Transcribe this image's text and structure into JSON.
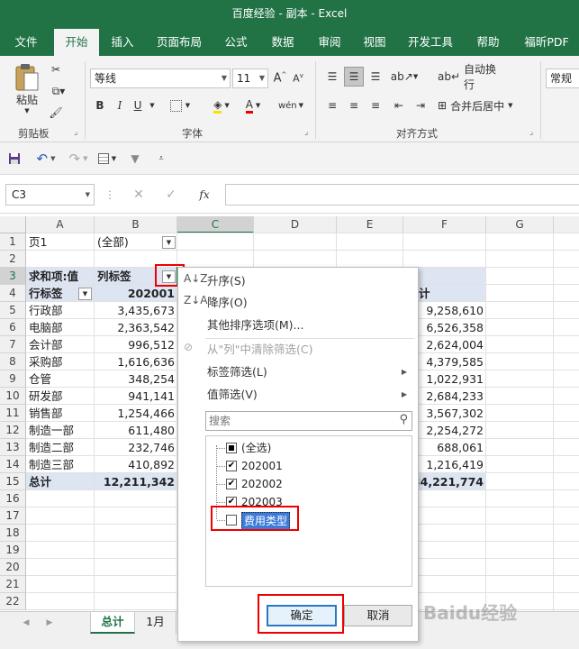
{
  "window": {
    "title": "百度经验 - 副本  -  Excel"
  },
  "ribbon_tabs": [
    "文件",
    "开始",
    "插入",
    "页面布局",
    "公式",
    "数据",
    "审阅",
    "视图",
    "开发工具",
    "帮助",
    "福昕PDF"
  ],
  "ribbon": {
    "paste_label": "粘贴",
    "clipboard_group": "剪贴板",
    "font_name": "等线",
    "font_size": "11",
    "font_group": "字体",
    "bold": "B",
    "italic": "I",
    "underline": "U",
    "wrap_text": "自动换行",
    "merge_center": "合并后居中",
    "align_group": "对齐方式",
    "number_format": "常规"
  },
  "formula_bar": {
    "name_box": "C3",
    "fx": "fx",
    "formula": ""
  },
  "columns": [
    "A",
    "B",
    "C",
    "D",
    "E",
    "F",
    "G"
  ],
  "rows": [
    "1",
    "2",
    "3",
    "4",
    "5",
    "6",
    "7",
    "8",
    "9",
    "10",
    "11",
    "12",
    "13",
    "14",
    "15",
    "16",
    "17",
    "18",
    "19",
    "20",
    "21",
    "22"
  ],
  "pivot": {
    "filter_label": "页1",
    "filter_value": "(全部)",
    "values_label": "求和项:值",
    "col_labels": "列标签",
    "row_labels": "行标签",
    "col_header_b": "202001",
    "col_header_f": "计",
    "rows": [
      {
        "label": "行政部",
        "b": "3,435,673",
        "f": "9,258,610"
      },
      {
        "label": "电脑部",
        "b": "2,363,542",
        "f": "6,526,358"
      },
      {
        "label": "会计部",
        "b": "996,512",
        "f": "2,624,004"
      },
      {
        "label": "采购部",
        "b": "1,616,636",
        "f": "4,379,585"
      },
      {
        "label": "仓管",
        "b": "348,254",
        "f": "1,022,931"
      },
      {
        "label": "研发部",
        "b": "941,141",
        "f": "2,684,233"
      },
      {
        "label": "销售部",
        "b": "1,254,466",
        "f": "3,567,302"
      },
      {
        "label": "制造一部",
        "b": "611,480",
        "f": "2,254,272"
      },
      {
        "label": "制造二部",
        "b": "232,746",
        "f": "688,061"
      },
      {
        "label": "制造三部",
        "b": "410,892",
        "f": "1,216,419"
      }
    ],
    "total_label": "总计",
    "total_b": "12,211,342",
    "total_f": "34,221,774"
  },
  "filter_menu": {
    "sort_asc": "升序(S)",
    "sort_desc": "降序(O)",
    "more_sort": "其他排序选项(M)...",
    "clear_filter": "从\"列\"中清除筛选(C)",
    "label_filter": "标签筛选(L)",
    "value_filter": "值筛选(V)",
    "search_placeholder": "搜索",
    "items": [
      {
        "label": "(全选)",
        "state": "partial"
      },
      {
        "label": "202001",
        "state": "checked"
      },
      {
        "label": "202002",
        "state": "checked"
      },
      {
        "label": "202003",
        "state": "checked"
      },
      {
        "label": "费用类型",
        "state": "unchecked"
      }
    ],
    "ok": "确定",
    "cancel": "取消"
  },
  "sheets": [
    "总计",
    "1月"
  ],
  "watermark": "Baidu经验",
  "colors": {
    "excel_green": "#217346",
    "highlight_red": "#e00000",
    "pivot_band": "#dde5f3"
  }
}
